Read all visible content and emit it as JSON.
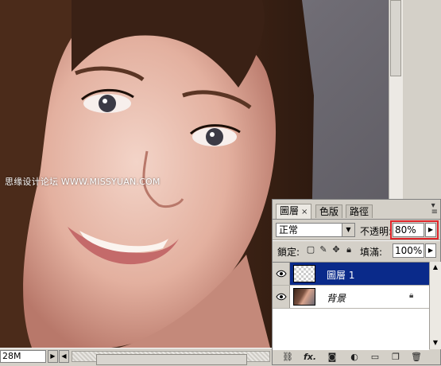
{
  "canvas": {
    "watermark": "思缘设计论坛 WWW.MISSYUAN.COM"
  },
  "statusbar": {
    "zoom": "28M"
  },
  "layers_panel": {
    "tabs": [
      {
        "label": "圖層",
        "close": "×",
        "active": true
      },
      {
        "label": "色版",
        "active": false
      },
      {
        "label": "路徑",
        "active": false
      }
    ],
    "blend_mode": "正常",
    "opacity_label": "不透明:",
    "opacity_value": "80%",
    "lock_label": "鎖定:",
    "fill_label": "填滿:",
    "fill_value": "100%",
    "layers": [
      {
        "name": "圖層 1",
        "selected": true,
        "visible": true,
        "thumbnail": "transparent-checker"
      },
      {
        "name": "背景",
        "selected": false,
        "visible": true,
        "locked": true,
        "thumbnail": "photo"
      }
    ],
    "bottom_icons": [
      "link-icon",
      "fx-icon",
      "layer-mask-icon",
      "adjustment-layer-icon",
      "new-group-icon",
      "new-layer-icon",
      "trash-icon"
    ],
    "fx_label": "fx."
  },
  "colors": {
    "selection": "#0a2a8a",
    "highlight_border": "#e0262b",
    "panel_bg": "#d4d0c8"
  }
}
